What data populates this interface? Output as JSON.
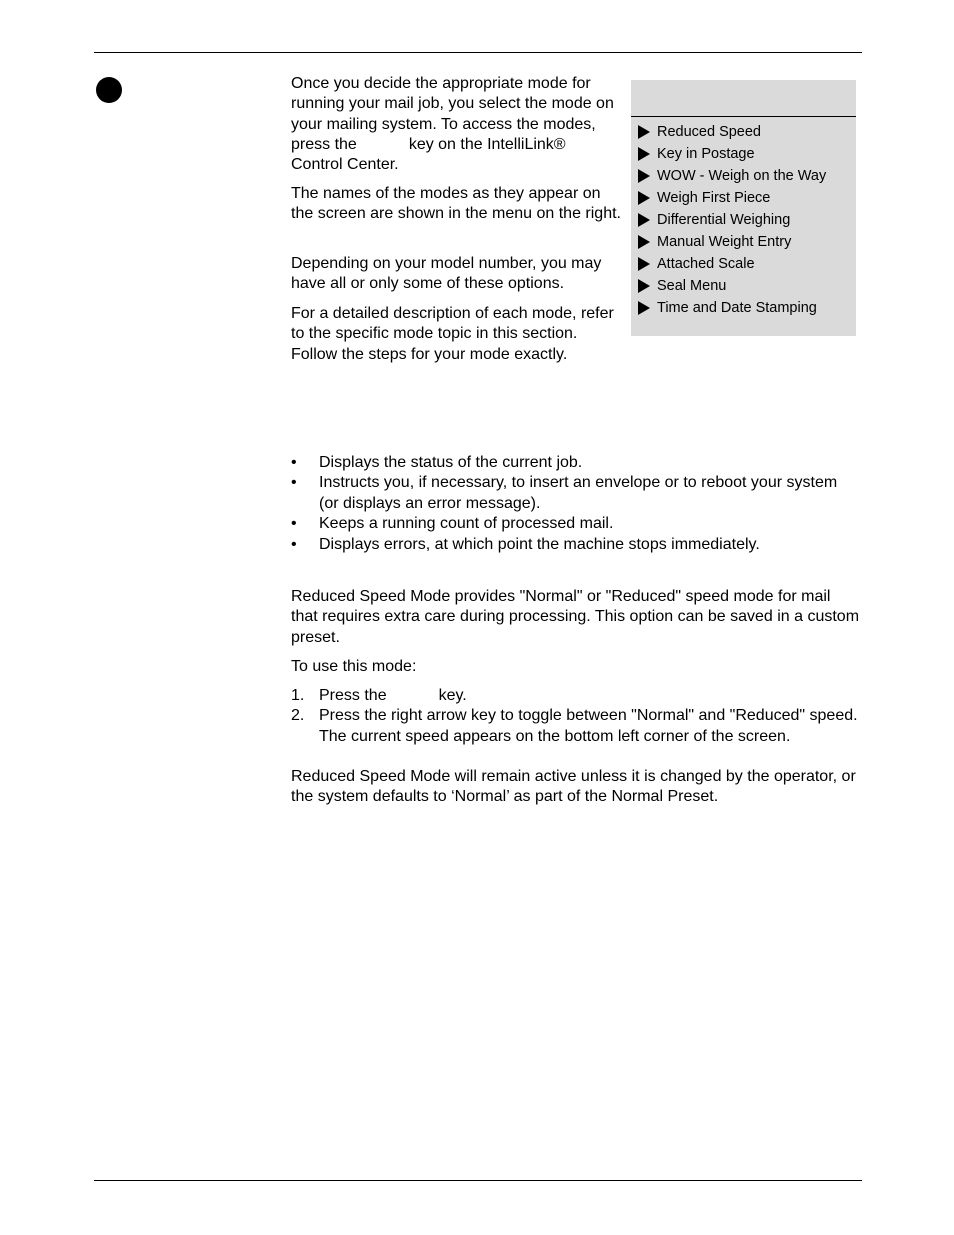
{
  "intro": {
    "p1_before": "Once you decide the appropriate mode for running your mail job, you select the mode on your mailing system. To access the modes, press the",
    "p1_after": "key on the IntelliLink® Control Center.",
    "p2": "The names of the modes as they appear on the screen are shown in the menu on the right.",
    "p3": "Depending on your model number, you may have all or only some of these options.",
    "p4": "For a detailed description of each mode, refer to the specific mode topic in this section. Follow the steps for your mode exactly."
  },
  "menu": {
    "items": [
      "Reduced Speed",
      "Key in Postage",
      "WOW - Weigh on the Way",
      "Weigh First Piece",
      "Differential Weighing",
      "Manual Weight Entry",
      "Attached Scale",
      "Seal Menu",
      "Time and Date Stamping"
    ]
  },
  "status_list": {
    "marker": "•",
    "items": [
      "Displays the status of the current job.",
      "Instructs you, if necessary, to insert an envelope or to reboot your system (or displays an error message).",
      "Keeps a running count of processed mail.",
      "Displays errors, at which point the machine stops immediately."
    ]
  },
  "reduced_speed": {
    "description": "Reduced Speed Mode provides \"Normal\" or \"Reduced\" speed mode for mail that requires extra care during processing. This option can be saved in a custom preset.",
    "intro": "To use this mode:",
    "step1_num": "1.",
    "step1_before": "Press the",
    "step1_after": "key.",
    "step2_num": "2.",
    "step2": "Press the right arrow key to toggle between \"Normal\" and \"Reduced\" speed. The current speed appears on the bottom left corner of the screen.",
    "note": "Reduced Speed Mode will remain active unless it is changed by the operator, or the system defaults to ‘Normal’ as part of the Normal Preset."
  }
}
